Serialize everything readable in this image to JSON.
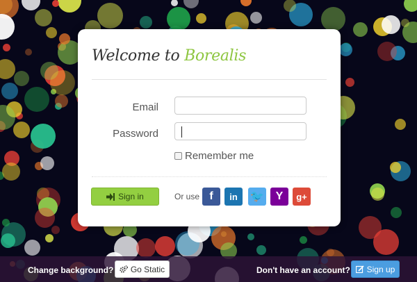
{
  "background": {
    "colors": [
      "#1fa34a",
      "#f2d22e",
      "#e8772b",
      "#2eb2e8",
      "#8fd14f",
      "#ffffff",
      "#ef4136",
      "#d6e04a",
      "#28c08e"
    ]
  },
  "card": {
    "title_prefix": "Welcome to ",
    "title_brand": "Borealis",
    "email_label": "Email",
    "password_label": "Password",
    "email_value": "",
    "password_value": "",
    "remember_label": "Remember me",
    "signin_label": "Sign in",
    "or_use_label": "Or use"
  },
  "social": [
    {
      "name": "facebook-button",
      "icon": "facebook-icon",
      "glyph": "f",
      "color": "#3b5998"
    },
    {
      "name": "linkedin-button",
      "icon": "linkedin-icon",
      "glyph": "in",
      "color": "#1c75b1"
    },
    {
      "name": "twitter-button",
      "icon": "twitter-icon",
      "glyph": "🐦",
      "color": "#55acee"
    },
    {
      "name": "yahoo-button",
      "icon": "yahoo-icon",
      "glyph": "Y",
      "color": "#7b0099"
    },
    {
      "name": "google-plus-button",
      "icon": "google-plus-icon",
      "glyph": "g+",
      "color": "#dd4b39"
    }
  ],
  "bottom": {
    "change_bg_label": "Change background?",
    "go_static_label": "Go Static",
    "no_account_label": "Don't have an account?",
    "signup_label": "Sign up"
  }
}
